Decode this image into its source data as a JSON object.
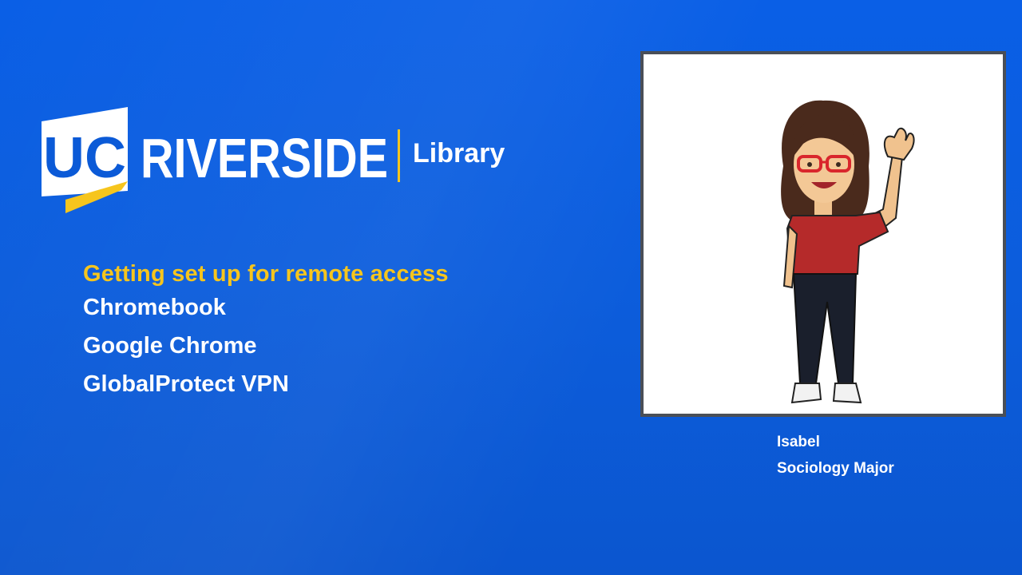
{
  "logo": {
    "uc": "UC",
    "riverside": "RIVERSIDE",
    "library": "Library"
  },
  "slide": {
    "subtitle": "Getting set up for remote access",
    "items": [
      "Chromebook",
      "Google Chrome",
      "GlobalProtect VPN"
    ]
  },
  "presenter": {
    "name": "Isabel",
    "role": "Sociology Major",
    "avatar_icon": "waving-avatar-illustration"
  },
  "colors": {
    "background": "#0d5fe0",
    "accent_gold": "#f6c51d",
    "text": "#ffffff",
    "frame": "#4a4f57"
  }
}
